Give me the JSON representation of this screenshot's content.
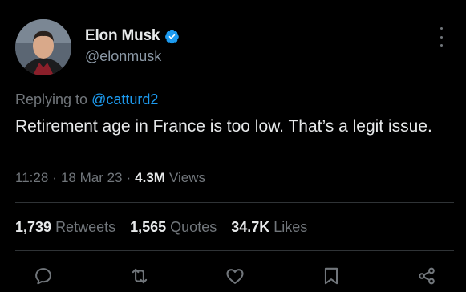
{
  "author": {
    "name": "Elon Musk",
    "handle": "@elonmusk",
    "verified": true
  },
  "reply": {
    "prefix": "Replying to",
    "mention": "@catturd2"
  },
  "tweet": {
    "text": "Retirement age in France is too low. That’s a legit issue.",
    "time": "11:28",
    "date": "18 Mar 23",
    "views_count": "4.3M",
    "views_label": "Views",
    "separator": "·"
  },
  "stats": [
    {
      "count": "1,739",
      "label": "Retweets"
    },
    {
      "count": "1,565",
      "label": "Quotes"
    },
    {
      "count": "34.7K",
      "label": "Likes"
    }
  ],
  "actions": [
    "reply-icon",
    "retweet-icon",
    "like-icon",
    "bookmark-icon",
    "share-icon"
  ],
  "colors": {
    "background": "#000000",
    "text_primary": "#e7e9ea",
    "text_secondary": "#71767b",
    "accent": "#1d9bf0",
    "divider": "#2f3336"
  }
}
